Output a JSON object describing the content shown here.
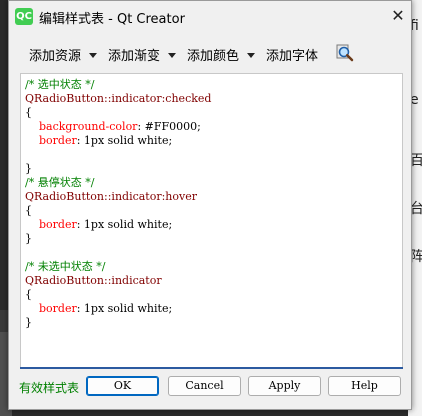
{
  "background": {
    "glyphs": [
      "fi",
      "e",
      "百",
      "台",
      "阵"
    ]
  },
  "window": {
    "app_icon": "QC",
    "title": "编辑样式表 - Qt Creator",
    "close": "✕"
  },
  "toolbar": {
    "add_resource": "添加资源",
    "add_gradient": "添加渐变",
    "add_color": "添加颜色",
    "add_font": "添加字体"
  },
  "editor": {
    "lines": [
      [
        {
          "t": "/* 选中状态 */",
          "k": "comment"
        }
      ],
      [
        {
          "t": "QRadioButton::indicator:checked",
          "k": "selector"
        }
      ],
      [
        {
          "t": "{",
          "k": "val"
        }
      ],
      [
        {
          "t": "    background-color",
          "k": "prop"
        },
        {
          "t": ": #FF0000;",
          "k": "val"
        }
      ],
      [
        {
          "t": "    border",
          "k": "prop"
        },
        {
          "t": ": 1px solid white;",
          "k": "val"
        }
      ],
      [
        {
          "t": "",
          "k": "val"
        }
      ],
      [
        {
          "t": "}",
          "k": "val"
        }
      ],
      [
        {
          "t": "/* 悬停状态 */",
          "k": "comment"
        }
      ],
      [
        {
          "t": "QRadioButton::indicator:hover",
          "k": "selector"
        }
      ],
      [
        {
          "t": "{",
          "k": "val"
        }
      ],
      [
        {
          "t": "    border",
          "k": "prop"
        },
        {
          "t": ": 1px solid white;",
          "k": "val"
        }
      ],
      [
        {
          "t": "}",
          "k": "val"
        }
      ],
      [
        {
          "t": "",
          "k": "val"
        }
      ],
      [
        {
          "t": "/* 未选中状态 */",
          "k": "comment"
        }
      ],
      [
        {
          "t": "QRadioButton::indicator",
          "k": "selector"
        }
      ],
      [
        {
          "t": "{",
          "k": "val"
        }
      ],
      [
        {
          "t": "    border",
          "k": "prop"
        },
        {
          "t": ": 1px solid white;",
          "k": "val"
        }
      ],
      [
        {
          "t": "}",
          "k": "val"
        }
      ]
    ]
  },
  "status": "有效样式表",
  "buttons": {
    "ok": "OK",
    "cancel": "Cancel",
    "apply": "Apply",
    "help": "Help"
  },
  "colors": {
    "comment": "#008000",
    "selector": "#800000",
    "property": "#ff0000",
    "accent": "#0067c0"
  }
}
